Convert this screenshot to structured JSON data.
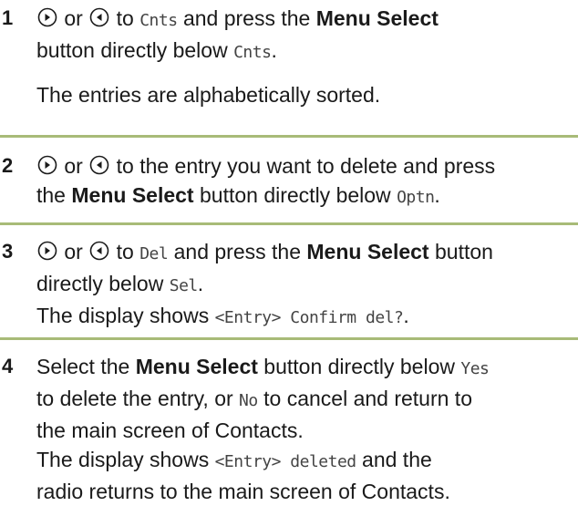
{
  "steps": [
    {
      "number": "1",
      "t1": "or",
      "t2": "to",
      "code1": "Cnts",
      "t3": "and press the",
      "bold1": "Menu Select",
      "t4": "button directly below",
      "code2": "Cnts",
      "t5": ".",
      "para2": "The entries are alphabetically sorted."
    },
    {
      "number": "2",
      "t1": "or",
      "t2": "to the entry you want to delete and press",
      "t3": "the",
      "bold1": "Menu Select",
      "t4": "button directly below",
      "code1": "Optn",
      "t5": "."
    },
    {
      "number": "3",
      "t1": "or",
      "t2": "to",
      "code1": "Del",
      "t3": "and press the",
      "bold1": "Menu Select",
      "t4": "button",
      "t5": "directly below",
      "code2": "Sel",
      "t6": ".",
      "t7": "The display shows",
      "code3": "<Entry> Confirm del?",
      "t8": "."
    },
    {
      "number": "4",
      "t1": "Select the",
      "bold1": "Menu Select",
      "t2": "button directly below",
      "code1": "Yes",
      "t3": "to delete the entry, or",
      "code2": "No",
      "t4": "to cancel and return to",
      "t5": "the main screen of Contacts.",
      "t6": "The display shows",
      "code3": "<Entry> deleted",
      "t7": "and the",
      "t8": "radio returns to the main screen of Contacts."
    }
  ],
  "icons": {
    "right": "nav-right-icon",
    "left": "nav-left-icon"
  },
  "colors": {
    "divider": "#a8bb78",
    "text": "#1a1a1a",
    "code": "#444444"
  }
}
